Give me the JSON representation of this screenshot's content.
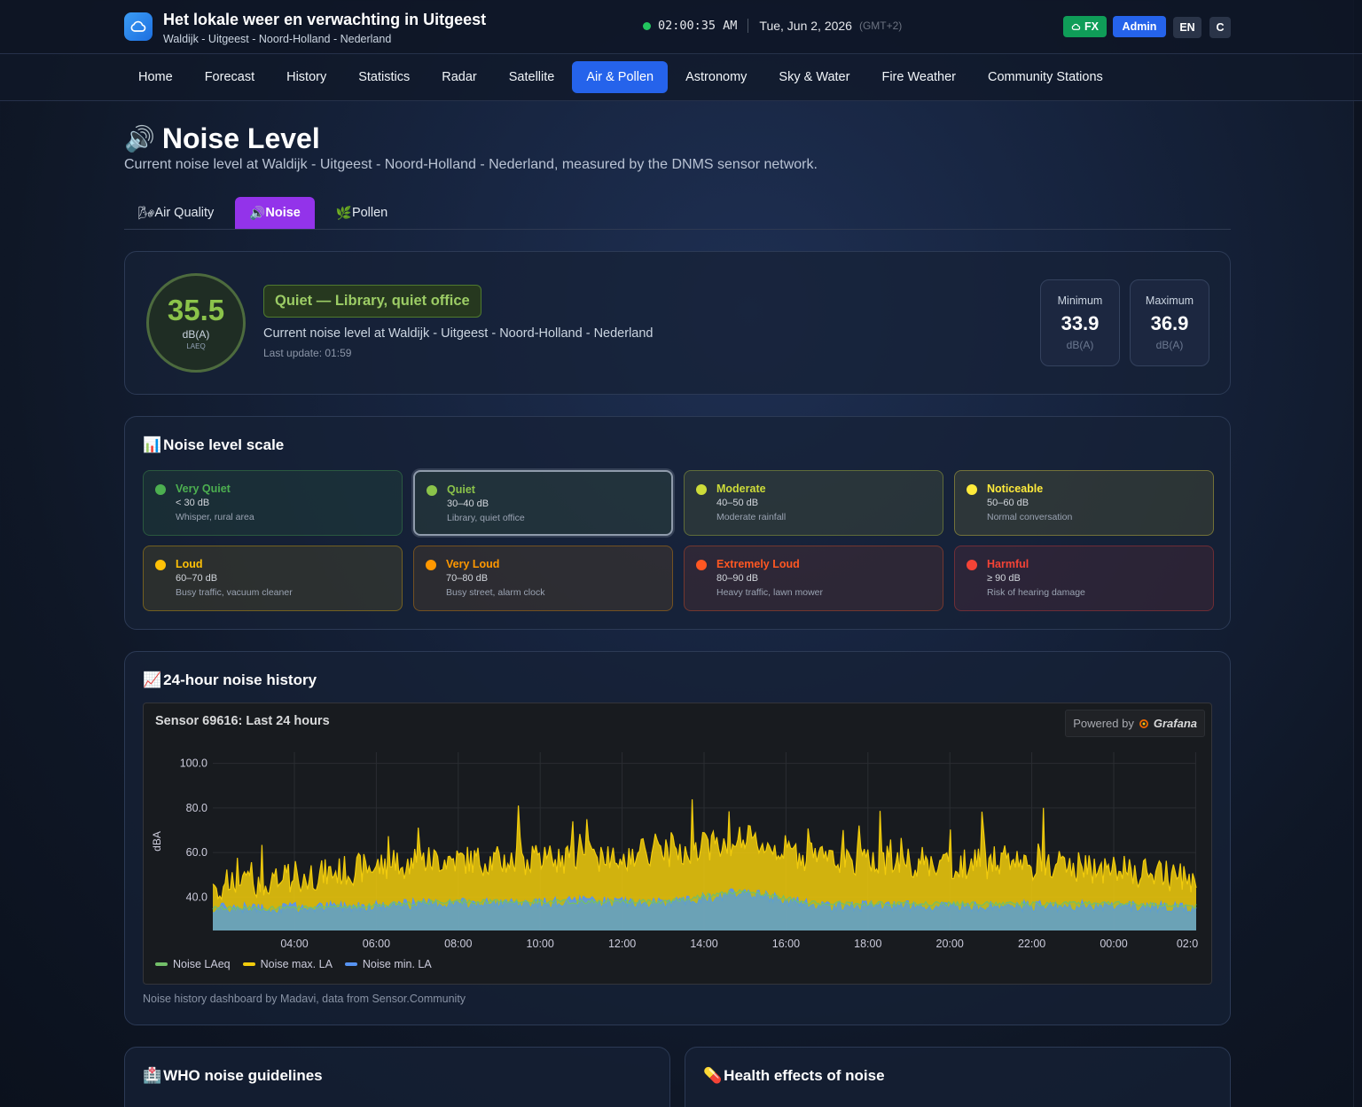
{
  "header": {
    "title": "Het lokale weer en verwachting in Uitgeest",
    "subtitle": "Waldijk - Uitgeest - Noord-Holland - Nederland",
    "time": "02:00:35 AM",
    "date": "Tue, Jun 2, 2026",
    "tz": "(GMT+2)",
    "fx_label": "FX",
    "admin_label": "Admin",
    "lang_label": "EN",
    "c_label": "C"
  },
  "nav": {
    "items": [
      "Home",
      "Forecast",
      "History",
      "Statistics",
      "Radar",
      "Satellite",
      "Air & Pollen",
      "Astronomy",
      "Sky & Water",
      "Fire Weather",
      "Community Stations"
    ],
    "active": "Air & Pollen"
  },
  "page": {
    "title": "Noise Level",
    "icon": "🔊",
    "description": "Current noise level at Waldijk - Uitgeest - Noord-Holland - Nederland, measured by the DNMS sensor network."
  },
  "subtabs": [
    {
      "icon": "🌬",
      "label": "Air Quality"
    },
    {
      "icon": "🔊",
      "label": "Noise"
    },
    {
      "icon": "🌿",
      "label": "Pollen"
    }
  ],
  "current": {
    "value": "35.5",
    "unit": "dB(A)",
    "sub": "LAEQ",
    "level": "Quiet — Library, quiet office",
    "text": "Current noise level at Waldijk - Uitgeest - Noord-Holland - Nederland",
    "last_update": "Last update: 01:59",
    "min_label": "Minimum",
    "min_value": "33.9",
    "min_unit": "dB(A)",
    "max_label": "Maximum",
    "max_value": "36.9",
    "max_unit": "dB(A)",
    "accent": "#8bc34a"
  },
  "scale": {
    "title": "Noise level scale",
    "icon": "📊",
    "items": [
      {
        "name": "Very Quiet",
        "range": "< 30 dB",
        "desc": "Whisper, rural area",
        "color": "#4caf50"
      },
      {
        "name": "Quiet",
        "range": "30–40 dB",
        "desc": "Library, quiet office",
        "color": "#8bc34a"
      },
      {
        "name": "Moderate",
        "range": "40–50 dB",
        "desc": "Moderate rainfall",
        "color": "#cddc39"
      },
      {
        "name": "Noticeable",
        "range": "50–60 dB",
        "desc": "Normal conversation",
        "color": "#ffeb3b"
      },
      {
        "name": "Loud",
        "range": "60–70 dB",
        "desc": "Busy traffic, vacuum cleaner",
        "color": "#ffc107"
      },
      {
        "name": "Very Loud",
        "range": "70–80 dB",
        "desc": "Busy street, alarm clock",
        "color": "#ff9800"
      },
      {
        "name": "Extremely Loud",
        "range": "80–90 dB",
        "desc": "Heavy traffic, lawn mower",
        "color": "#ff5722"
      },
      {
        "name": "Harmful",
        "range": "≥ 90 dB",
        "desc": "Risk of hearing damage",
        "color": "#f44336"
      }
    ],
    "current_index": 1
  },
  "history": {
    "title": "24-hour noise history",
    "icon": "📈",
    "caption": "Noise history dashboard by Madavi, data from Sensor.Community"
  },
  "chart_data": {
    "type": "area",
    "title": "Sensor 69616: Last 24 hours",
    "powered_by": "Powered by",
    "brand": "Grafana",
    "ylabel": "dBA",
    "ylim": [
      25,
      105
    ],
    "yticks": [
      "100.0",
      "80.0",
      "60.0",
      "40.0"
    ],
    "xticks": [
      "04:00",
      "06:00",
      "08:00",
      "10:00",
      "12:00",
      "14:00",
      "16:00",
      "18:00",
      "20:00",
      "22:00",
      "00:00",
      "02:0"
    ],
    "x": [
      "02:00",
      "04:00",
      "06:00",
      "08:00",
      "10:00",
      "12:00",
      "14:00",
      "15:00",
      "16:00",
      "18:00",
      "20:00",
      "22:00",
      "00:00",
      "02:00"
    ],
    "series": [
      {
        "name": "Noise LAeq",
        "color": "#73bf69",
        "values": [
          35,
          35,
          36,
          38,
          38,
          38,
          38,
          43,
          37,
          37,
          37,
          37,
          37,
          36
        ]
      },
      {
        "name": "Noise max. LA",
        "color": "#f2cc0c",
        "values": [
          45,
          48,
          53,
          57,
          56,
          58,
          60,
          66,
          57,
          56,
          55,
          54,
          52,
          48
        ]
      },
      {
        "name": "Noise min. LA",
        "color": "#5794f2",
        "values": [
          34,
          34,
          35,
          36,
          36,
          37,
          36,
          41,
          35,
          35,
          35,
          35,
          35,
          34
        ]
      }
    ]
  },
  "bottom": {
    "who_title": "WHO noise guidelines",
    "who_icon": "🏥",
    "health_title": "Health effects of noise",
    "health_icon": "💊"
  }
}
